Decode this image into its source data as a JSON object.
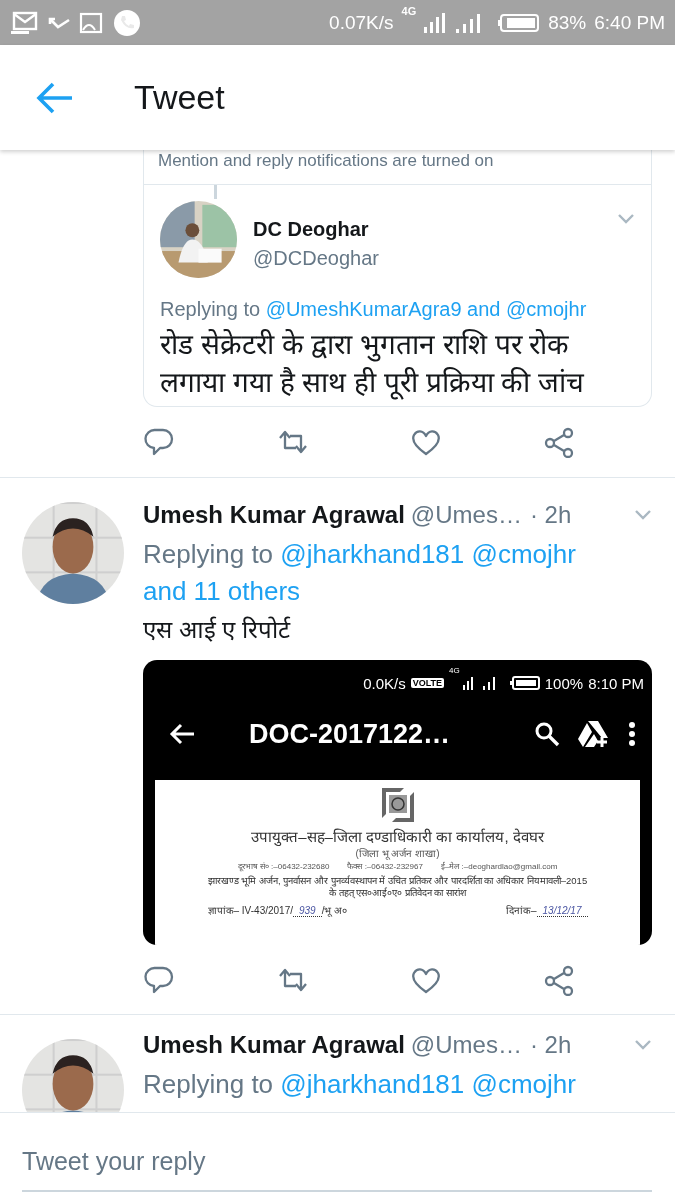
{
  "status_bar": {
    "speed": "0.07K/s",
    "network": "4G",
    "battery": "83%",
    "time": "6:40 PM"
  },
  "header": {
    "title": "Tweet"
  },
  "quoted_tweet": {
    "notice": "Mention and reply notifications are turned on",
    "name": "DC Deoghar",
    "handle": "@DCDeoghar",
    "replying_label": "Replying to",
    "replying_to": [
      "@UmeshKumarAgra9 and @cmojhr"
    ],
    "text": "रोड सेक्रेटरी के द्वारा भुगतान राशि पर रोक लगाया गया है साथ ही पूरी प्रक्रिया की जांच"
  },
  "tweets": [
    {
      "name": "Umesh Kumar Agrawal",
      "handle": "@Umes…",
      "time": "· 2h",
      "replying_label": "Replying to",
      "replying_to": [
        "@jharkhand181",
        "@cmojhr",
        "and 11 others"
      ],
      "text": "एस आई ए रिपोर्ट",
      "media": {
        "kind": "screenshot",
        "status_bar": {
          "speed": "0.0K/s",
          "volte": "VOLTE",
          "network": "4G",
          "battery": "100%",
          "time": "8:10 PM"
        },
        "title": "DOC-2017122…",
        "document": {
          "office": "उपायुक्त–सह–जिला दण्डाधिकारी का कार्यालय, देवघर",
          "branch": "(जिला भू अर्जन शाखा)",
          "contacts": [
            "दूरभाष सं० :–06432-232680",
            "फैक्स :–06432-232967",
            "ई–मेल :–deoghardlao@gmail.com"
          ],
          "subject": "झारखण्ड भूमि अर्जन, पुनर्वासन और पुनर्व्यवस्थापन में उचित प्रतिकर और पारदर्शिता का अधिकार नियमावली–2015 के तहत् एस०आई०ए० प्रतिवेदन का सारांश",
          "memo_prefix": "ज्ञापांक– IV-43/2017/",
          "memo_number": "939",
          "memo_suffix": "/भू अ०",
          "date_label": "दिनांक–",
          "date": "13/12/17"
        }
      }
    },
    {
      "name": "Umesh Kumar Agrawal",
      "handle": "@Umes…",
      "time": "· 2h",
      "replying_label": "Replying to",
      "replying_to": [
        "@jharkhand181",
        "@cmojhr"
      ]
    }
  ],
  "reply_box": {
    "placeholder": "Tweet your reply"
  }
}
